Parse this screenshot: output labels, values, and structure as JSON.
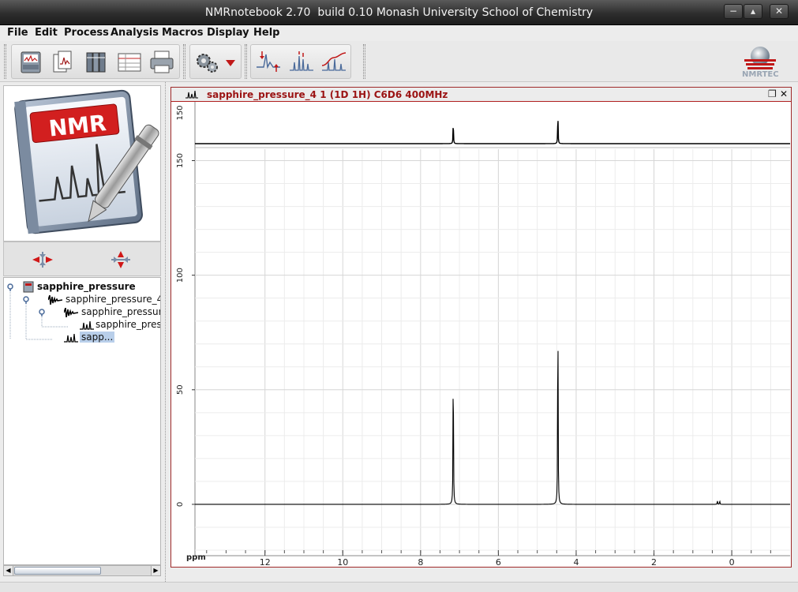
{
  "window": {
    "title": "NMRnotebook 2.70  build 0.10 Monash University School of Chemistry",
    "minimize_glyph": "−",
    "maximize_glyph": "▴",
    "close_glyph": "✕"
  },
  "menu": [
    "File",
    "Edit",
    "Process",
    "Analysis",
    "Macros",
    "Display",
    "Help"
  ],
  "toolbar": {
    "groups": [
      {
        "icons": [
          "notebook-icon",
          "open-documents-icon",
          "library-icon",
          "table-view-icon",
          "print-icon"
        ]
      },
      {
        "icons": [
          "settings-gears-icon",
          "dropdown-arrow-icon"
        ]
      },
      {
        "icons": [
          "peak-pick-icon",
          "multiplet-icon",
          "integration-icon"
        ]
      }
    ],
    "brand_label": "NMRTEC"
  },
  "left_panel": {
    "logo_text": "NMR",
    "collapse_icons": [
      "collapse-horizontal-icon",
      "collapse-vertical-icon"
    ],
    "tree": [
      {
        "label": "sapphire_pressure",
        "level": 0,
        "icon": "notebook-icon",
        "bold": true
      },
      {
        "label": "sapphire_pressure_4",
        "level": 1,
        "icon": "fid-icon"
      },
      {
        "label": "sapphire_pressure",
        "level": 2,
        "icon": "fid-icon"
      },
      {
        "label": "sapphire_press",
        "level": 3,
        "icon": "spectrum-icon"
      },
      {
        "label": "sapp...",
        "level": 2,
        "icon": "spectrum-icon",
        "selected": true
      }
    ]
  },
  "spectrum_window": {
    "title": "sapphire_pressure_4 1 (1D 1H) C6D6 400MHz",
    "restore_glyph": "❐",
    "close_glyph": "✕"
  },
  "chart_data": {
    "type": "line",
    "x_label": "ppm",
    "x_range": [
      13.8,
      -1.5
    ],
    "x_ticks": [
      12,
      10,
      8,
      6,
      4,
      2,
      0
    ],
    "x_reversed": true,
    "y_range": [
      -20,
      155
    ],
    "y_ticks": [
      0,
      50,
      100,
      150
    ],
    "grid": true,
    "peaks": [
      {
        "ppm": 7.16,
        "height": 73
      },
      {
        "ppm": 4.47,
        "height": 100
      },
      {
        "ppm": 0.37,
        "height": 1.8
      },
      {
        "ppm": 0.31,
        "height": 1.8
      }
    ],
    "overview_panel": {
      "y_tick": 150,
      "peaks": [
        {
          "ppm": 7.16,
          "height": 73
        },
        {
          "ppm": 4.47,
          "height": 100
        }
      ]
    }
  }
}
